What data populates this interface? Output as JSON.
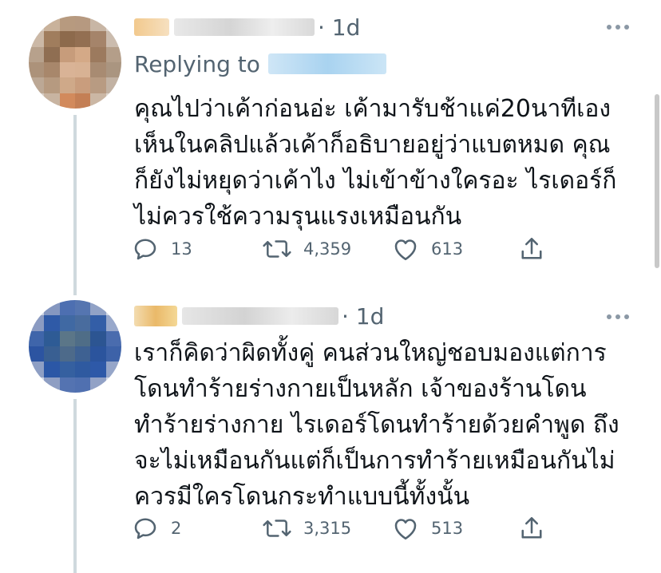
{
  "tweets": [
    {
      "time": "· 1d",
      "replying_to_label": "Replying to",
      "text": "คุณไปว่าเค้าก่อนอ่ะ เค้ามารับช้าแค่20นาทีเอง\nเห็นในคลิปแล้วเค้าก็อธิบายอยู่ว่าแบตหมด คุณ\nก็ยังไม่หยุดว่าเค้าไง ไม่เข้าข้างใครอะ ไรเดอร์ก็\nไม่ควรใช้ความรุนแรงเหมือนกัน",
      "replies": "13",
      "retweets": "4,359",
      "likes": "613"
    },
    {
      "time": "· 1d",
      "text": "เราก็คิดว่าผิดทั้งคู่ คนส่วนใหญ่ชอบมองแต่การ\nโดนทำร้ายร่างกายเป็นหลัก เจ้าของร้านโดน\nทำร้ายร่างกาย ไรเดอร์โดนทำร้ายด้วยคำพูด ถึง\nจะไม่เหมือนกันแต่ก็เป็นการทำร้ายเหมือนกันไม่\nควรมีใครโดนกระทำแบบนี้ทั้งนั้น",
      "replies": "2",
      "retweets": "3,315",
      "likes": "513"
    }
  ],
  "icons": {
    "reply": "reply-icon",
    "retweet": "retweet-icon",
    "like": "like-icon",
    "share": "share-icon",
    "more": "more-icon"
  },
  "colors": {
    "text": "#0f1419",
    "secondary": "#536471",
    "thread_line": "#cfd9de"
  }
}
